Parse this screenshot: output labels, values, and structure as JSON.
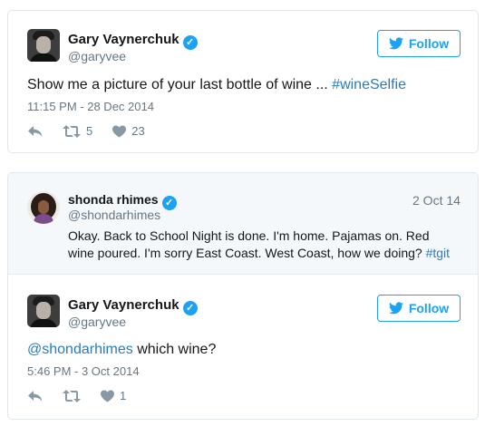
{
  "tweet1": {
    "name": "Gary Vaynerchuk",
    "handle": "@garyvee",
    "follow_label": "Follow",
    "text_plain": "Show me a picture of your last bottle of wine ... ",
    "text_hashtag": "#wineSelfie",
    "timestamp": "11:15 PM - 28 Dec 2014",
    "retweets": "5",
    "likes": "23"
  },
  "quoted": {
    "name": "shonda rhimes",
    "handle": "@shondarhimes",
    "date": "2 Oct 14",
    "line1": "Okay. Back to School Night is done. I'm home. Pajamas on. Red",
    "line2_plain": "wine poured. I'm sorry East Coast. West Coast, how we doing? ",
    "line2_hashtag": "#tgit"
  },
  "tweet2": {
    "name": "Gary Vaynerchuk",
    "handle": "@garyvee",
    "follow_label": "Follow",
    "mention": "@shondarhimes",
    "text_plain": " which wine?",
    "timestamp": "5:46 PM - 3 Oct 2014",
    "likes": "1"
  },
  "colors": {
    "accent": "#1da1f2",
    "link": "#2b7bb9",
    "muted": "#657786",
    "quoted_bg": "#f5f8fa"
  }
}
